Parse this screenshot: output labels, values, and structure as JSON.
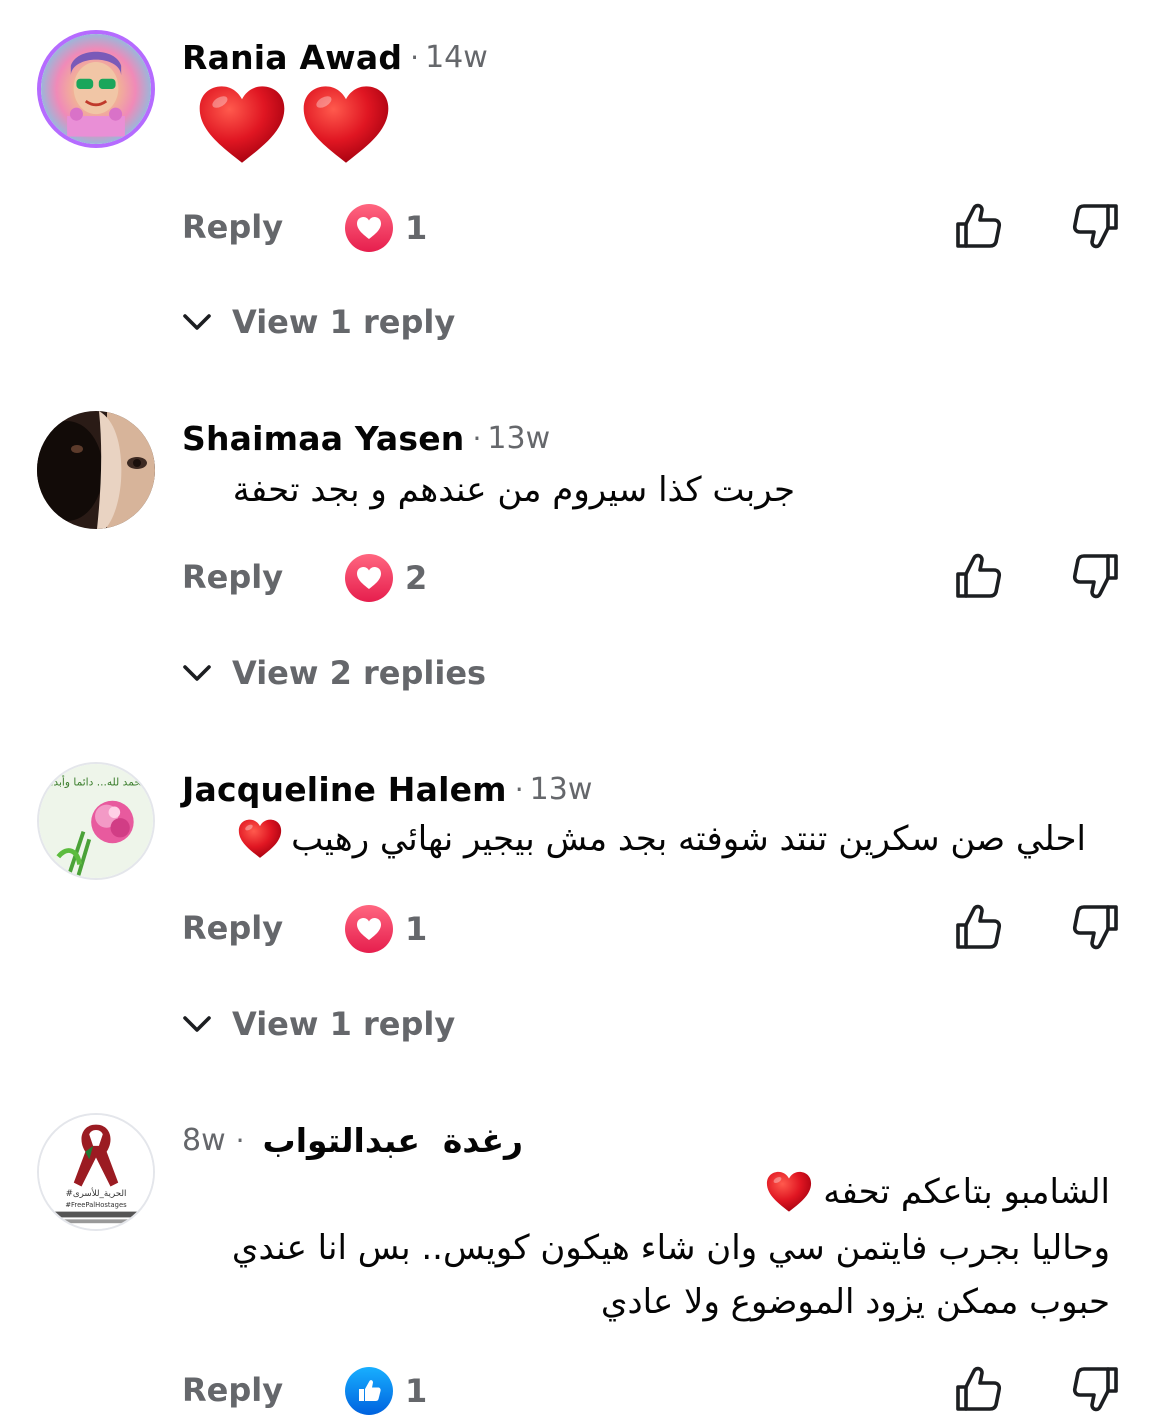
{
  "comments": [
    {
      "author": "Rania Awad",
      "time": "14w",
      "text": "",
      "emoji": "two-red-hearts",
      "reply_label": "Reply",
      "reaction": {
        "type": "love",
        "count": "1"
      },
      "view_replies": "View 1 reply"
    },
    {
      "author": "Shaimaa Yasen",
      "time": "13w",
      "text": "جربت كذا سيروم من عندهم و بجد تحفة",
      "reply_label": "Reply",
      "reaction": {
        "type": "love",
        "count": "2"
      },
      "view_replies": "View 2 replies"
    },
    {
      "author": "Jacqueline Halem",
      "time": "13w",
      "text": "احلي صن سكرين تنتد شوفته بجد مش بيجير نهائي رهيب",
      "reply_label": "Reply",
      "reaction": {
        "type": "love",
        "count": "1"
      },
      "view_replies": "View 1 reply"
    },
    {
      "author": "رغدة  عبدالتواب",
      "time": "8w",
      "text_lines": [
        "الشامبو بتاعكم تحفه",
        "وحاليا بجرب فايتمن سي وان شاء هيكون كويس.. بس انا عندي",
        "حبوب ممكن يزود الموضوع ولا عادي"
      ],
      "reply_label": "Reply",
      "reaction": {
        "type": "like",
        "count": "1"
      }
    }
  ],
  "avatar_texts": {
    "c3": "الحمد لله... دائما وأبدا",
    "c4_top": "#الحرية_للأسرى",
    "c4_bottom": "#FreePalHostages"
  },
  "icons": {
    "like_outline": "thumbs-up-icon",
    "dislike_outline": "thumbs-down-icon",
    "chevron": "chevron-down-icon"
  },
  "colors": {
    "secondary_text": "#65676b",
    "love": "#f33e58",
    "like": "#1877f2"
  }
}
